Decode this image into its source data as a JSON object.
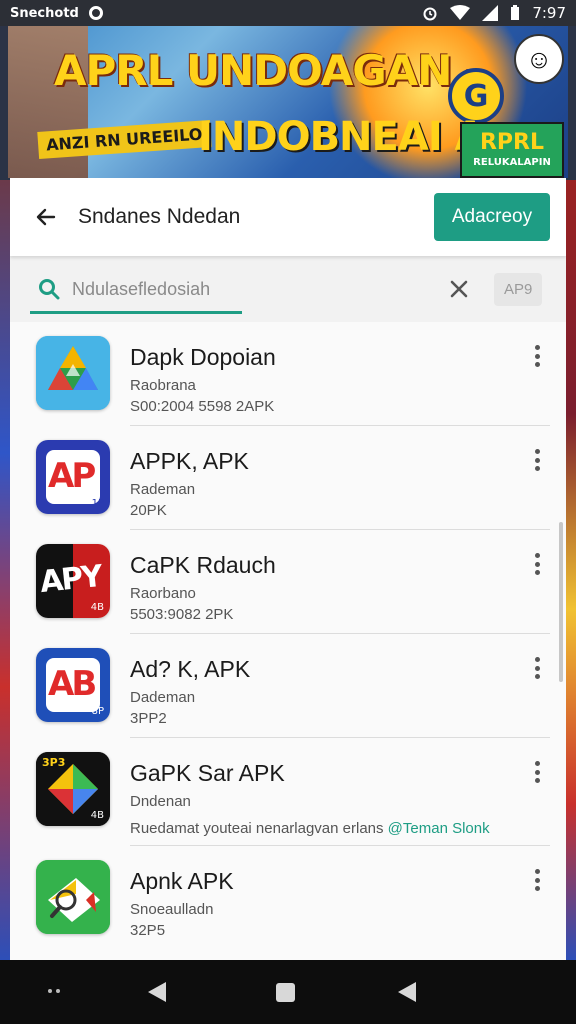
{
  "status_bar": {
    "carrier": "Snechotd",
    "time": "7:97"
  },
  "banner": {
    "title_line1": "APRL UNDOAGAN -",
    "title_line2": "INDOBNEAI A",
    "subtitle": "ANZI RN UREEILO",
    "coin_letter": "G",
    "badge_top": "RPRL",
    "badge_bottom": "RELUKALAPIN"
  },
  "app_bar": {
    "title": "Sndanes Ndedan",
    "install_label": "Adacreoy"
  },
  "search": {
    "query": "Ndulasefledosiah",
    "filter_label": "AP9"
  },
  "apps": [
    {
      "name": "Dapk Dopoian",
      "developer": "Raobrana",
      "meta": "S00:2004 5598 2APK",
      "tag": ""
    },
    {
      "name": "APPK, APK",
      "developer": "Rademan",
      "meta": "20PK",
      "tag": "",
      "icon_text": "AP",
      "icon_small": "1P"
    },
    {
      "name": "CaPK Rdauch",
      "developer": "Raorbano",
      "meta": "5503:9082 2PK",
      "tag": "",
      "icon_text": "APY",
      "icon_small": "4B"
    },
    {
      "name": "Ad? K, APK",
      "developer": "Dademan",
      "meta": "3PP2",
      "tag": "",
      "icon_text": "AB",
      "icon_small": "8P"
    },
    {
      "name": "GaPK Sar APK",
      "developer": "Dndenan",
      "meta": "Ruedamat youteai nenarlagvan erlans",
      "tag": "@Teman Slonk",
      "icon_text": "3P3",
      "icon_small": "4B"
    },
    {
      "name": "Apnk APK",
      "developer": "Snoeaulladn",
      "meta": "32P5",
      "tag": ""
    }
  ],
  "colors": {
    "accent": "#1e9d84",
    "banner_yellow": "#ffd21a"
  }
}
